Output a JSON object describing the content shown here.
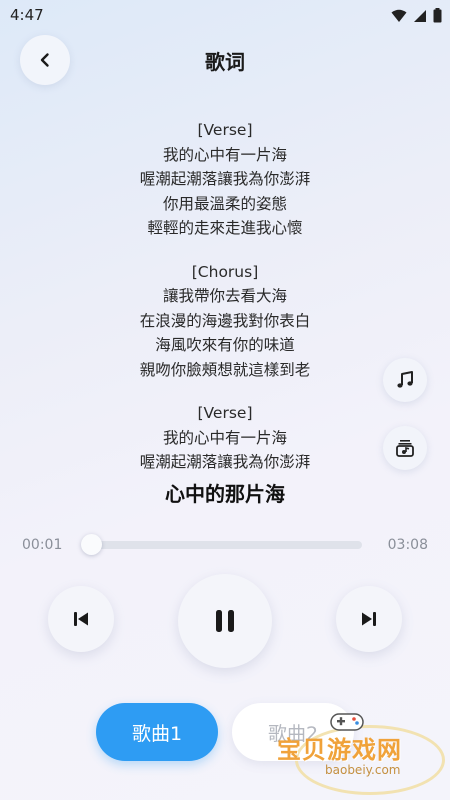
{
  "status_bar": {
    "time": "4:47"
  },
  "header": {
    "title": "歌词"
  },
  "lyrics": [
    {
      "section": "[Verse]",
      "lines": [
        "我的心中有一片海",
        "喔潮起潮落讓我為你澎湃",
        "你用最溫柔的姿態",
        "輕輕的走來走進我心懷"
      ]
    },
    {
      "section": "[Chorus]",
      "lines": [
        "讓我帶你去看大海",
        "在浪漫的海邊我對你表白",
        "海風吹來有你的味道",
        "親吻你臉頰想就這樣到老"
      ]
    },
    {
      "section": "[Verse]",
      "lines": [
        "我的心中有一片海",
        "喔潮起潮落讓我為你澎湃"
      ]
    }
  ],
  "song": {
    "title": "心中的那片海"
  },
  "player": {
    "current_time": "00:01",
    "total_time": "03:08",
    "progress": 0.005
  },
  "tabs": [
    {
      "label": "歌曲1"
    },
    {
      "label": "歌曲2"
    }
  ],
  "watermark": {
    "text": "宝贝游戏网",
    "url": "baobeiy.com"
  },
  "colors": {
    "accent": "#2e9cf3"
  },
  "icons": {
    "back": "chevron-left-icon",
    "music": "music-note-icon",
    "album": "album-icon",
    "prev": "skip-previous-icon",
    "pause": "pause-icon",
    "next": "skip-next-icon"
  }
}
